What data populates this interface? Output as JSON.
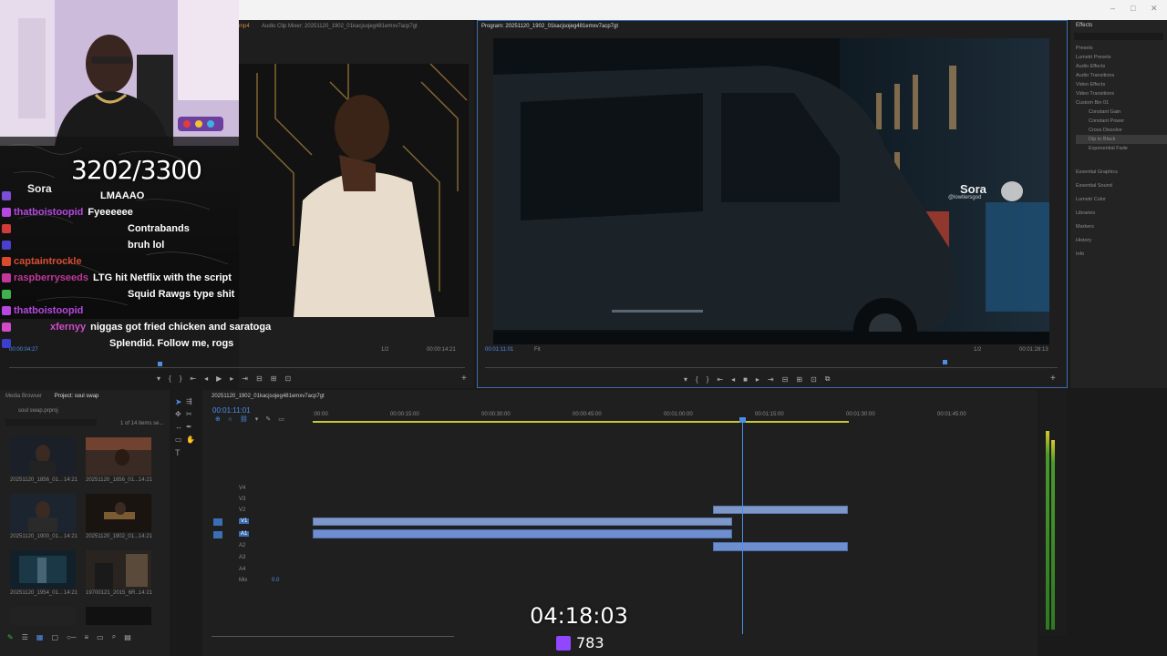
{
  "window": {
    "minimize": "–",
    "maximize": "□",
    "close": "✕"
  },
  "source_monitor": {
    "tabs": [
      "mp4",
      "Audio Clip Mixer: 20251120_1902_01kacjsojeg481emxv7acp7gt"
    ],
    "timecode_left": "00:00:04:27",
    "fraction": "1/2",
    "timecode_right": "00:00:14:21"
  },
  "program_monitor": {
    "title": "Program: 20251120_1902_01kacjsojeg481emxv7acp7gt",
    "timecode": "00:01:11:01",
    "fit": "Fit",
    "fraction": "1/2",
    "duration": "00:01:28:13",
    "watermark_name": "Sora",
    "watermark_handle": "@lowtiersgod"
  },
  "effects": {
    "title": "Effects",
    "tree": [
      "Presets",
      "Lumetri Presets",
      "Audio Effects",
      "Audio Transitions",
      "Video Effects",
      "Video Transitions",
      "Custom Bin 01",
      "Constant Gain",
      "Constant Power",
      "Cross Dissolve",
      "Dip to Black",
      "Exponential Fade"
    ],
    "panels": [
      "Essential Graphics",
      "Essential Sound",
      "Lumetri Color",
      "Libraries",
      "Markers",
      "History",
      "Info"
    ]
  },
  "project": {
    "tabs": [
      "Media Browser",
      "Project: soul swap"
    ],
    "file": "soul swap.prproj",
    "count": "1 of 14 items se...",
    "thumbs": [
      {
        "name": "20251120_1856_01...",
        "dur": "14:21"
      },
      {
        "name": "20251120_1856_01...",
        "dur": "14:21"
      },
      {
        "name": "20251120_1900_01...",
        "dur": "14:21"
      },
      {
        "name": "20251120_1902_01...",
        "dur": "14:21"
      },
      {
        "name": "20251120_1954_01...",
        "dur": "14:21"
      },
      {
        "name": "19700121_2015_6R...",
        "dur": "14:21"
      }
    ]
  },
  "timeline": {
    "sequence": "20251120_1902_01kacjsojeg481emxv7acp7gt",
    "timecode": "00:01:11:01",
    "ruler": [
      ":00:00",
      "00:00:15:00",
      "00:00:30:00",
      "00:00:45:00",
      "00:01:00:00",
      "00:01:15:00",
      "00:01:30:00",
      "00:01:45:00"
    ],
    "video_tracks": [
      "V4",
      "V3",
      "V2",
      "V1"
    ],
    "audio_tracks": [
      "A1",
      "A2",
      "A3",
      "A4"
    ],
    "mix": "Mix",
    "mix_value": "0.0"
  },
  "stream": {
    "goal": "3202/3300",
    "sora_badge": "Sora",
    "chat": [
      {
        "user": "",
        "msg": "LMAAAO",
        "color": "#7b4ed8"
      },
      {
        "user": "thatboistoopid",
        "msg": "Fyeeeeee",
        "color": "#b548e0"
      },
      {
        "user": "",
        "msg": "Contrabands",
        "color": "#d23a3a"
      },
      {
        "user": "",
        "msg": "bruh lol",
        "color": "#4b3fd0"
      },
      {
        "user": "captaintrockle",
        "msg": "",
        "color": "#d64a2e"
      },
      {
        "user": "raspberryseeds",
        "msg": "LTG hit Netflix with the script",
        "color": "#c0389a"
      },
      {
        "user": "",
        "msg": "Squid Rawgs type shit",
        "color": "#3fb24b"
      },
      {
        "user": "thatboistoopid",
        "msg": "",
        "color": "#b548e0"
      },
      {
        "user": "xfernyy",
        "msg": "niggas got fried chicken and saratoga",
        "color": "#d24cc8"
      },
      {
        "user": "",
        "msg": "Splendid. Follow me, rogs",
        "color": "#3b3fd0"
      }
    ],
    "timer": "04:18:03",
    "viewers": "783"
  }
}
